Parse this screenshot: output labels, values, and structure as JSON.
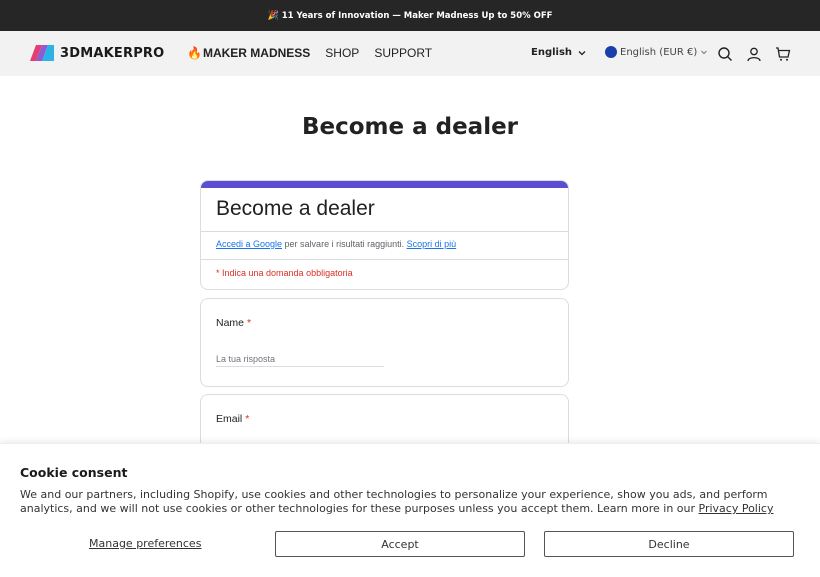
{
  "announcement": {
    "emoji": "🎉",
    "text": "11 Years of Innovation — Maker Madness Up to 50% OFF"
  },
  "header": {
    "logo_text": "3DMAKERPRO",
    "nav": [
      {
        "label": "MAKER MADNESS",
        "prefix": "🔥"
      },
      {
        "label": "SHOP"
      },
      {
        "label": "SUPPORT"
      }
    ],
    "language": "English",
    "currency": "English (EUR €)"
  },
  "page": {
    "title": "Become a dealer"
  },
  "form": {
    "title": "Become a dealer",
    "signin_link": "Accedi a Google",
    "signin_text": " per salvare i risultati raggiunti. ",
    "learn_more": "Scopri di più",
    "required_note": "* Indica una domanda obbligatoria",
    "questions": [
      {
        "label": "Name",
        "required_mark": "*",
        "placeholder": "La tua risposta"
      },
      {
        "label": "Email",
        "required_mark": "*"
      }
    ]
  },
  "cookie": {
    "title": "Cookie consent",
    "text": "We and our partners, including Shopify, use cookies and other technologies to personalize your experience, show you ads, and perform analytics, and we will not use cookies or other technologies for these purposes unless you accept them. Learn more in our ",
    "policy_link": "Privacy Policy",
    "manage_label": "Manage preferences",
    "accept_label": "Accept",
    "decline_label": "Decline"
  },
  "colors": {
    "accent": "#5b4ed1",
    "required": "#d93025",
    "link": "#1a73e8",
    "topbar": "#262626"
  }
}
